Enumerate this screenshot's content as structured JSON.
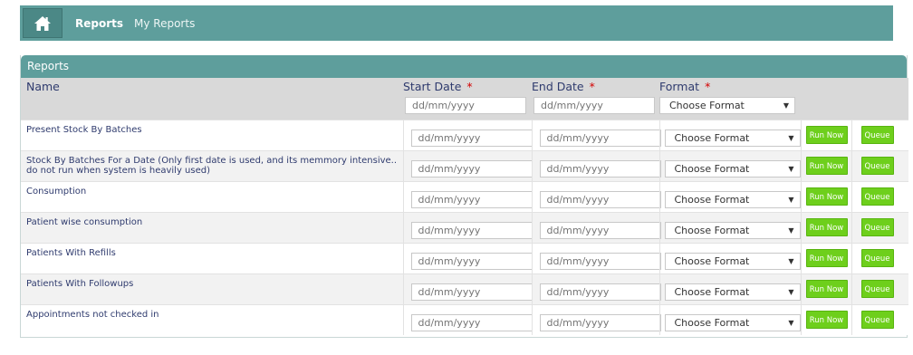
{
  "nav": {
    "home_label": "Home",
    "links": [
      "Reports",
      "My Reports"
    ]
  },
  "panel": {
    "title": "Reports",
    "columns": {
      "name": "Name",
      "start_date": "Start Date",
      "end_date": "End Date",
      "format": "Format",
      "required_mark": "*"
    },
    "date_placeholder": "dd/mm/yyyy",
    "format_placeholder": "Choose Format",
    "run_label": "Run Now",
    "queue_label": "Queue",
    "reports": [
      "Present Stock By Batches",
      "Stock By Batches For a Date (Only first date is used, and its memmory intensive.. do not run when system is heavily used)",
      "Consumption",
      "Patient wise consumption",
      "Patients With Refills",
      "Patients With Followups",
      "Appointments not checked in"
    ]
  },
  "colors": {
    "header_bg": "#5e9e9c",
    "button_green": "#6ecf1c",
    "required_red": "#d40000",
    "title_text": "#2f3b6e"
  }
}
